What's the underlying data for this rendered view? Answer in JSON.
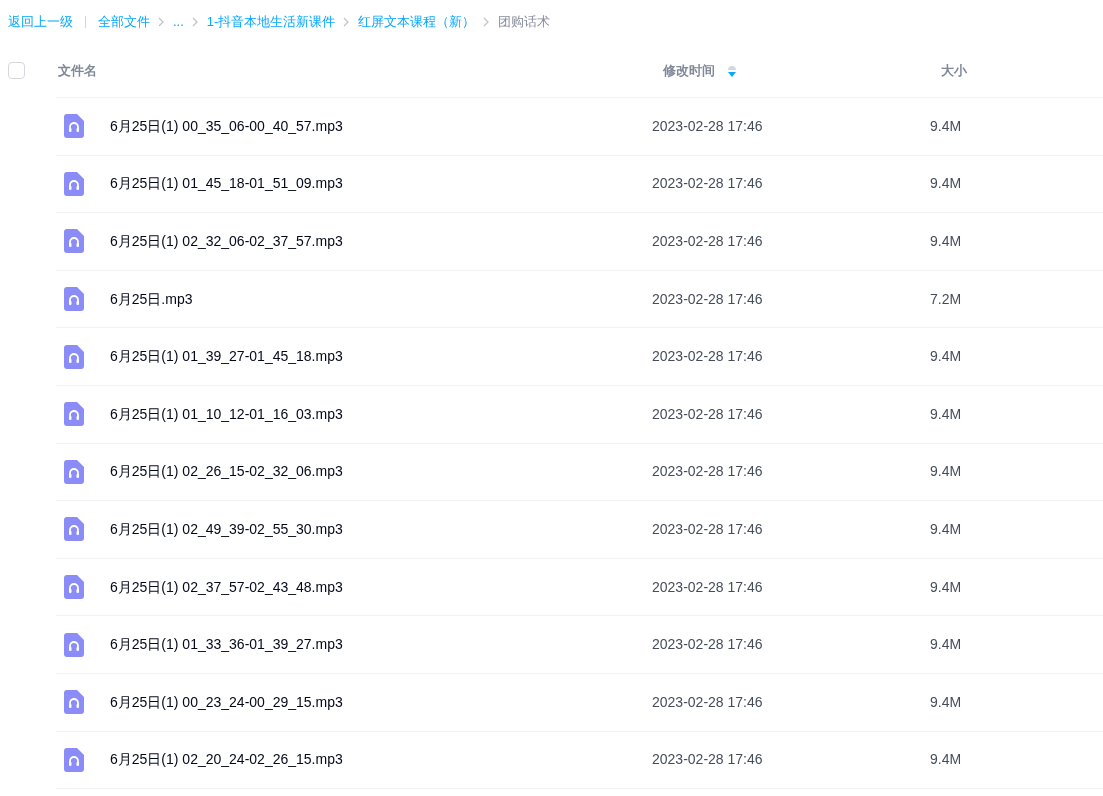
{
  "breadcrumb": {
    "back": "返回上一级",
    "items": [
      {
        "label": "全部文件",
        "current": false
      },
      {
        "label": "...",
        "current": false
      },
      {
        "label": "1-抖音本地生活新课件",
        "current": false
      },
      {
        "label": "红屏文本课程（新）",
        "current": false
      },
      {
        "label": "团购话术",
        "current": true
      }
    ]
  },
  "table": {
    "select_all": {
      "checked": false
    },
    "columns": [
      {
        "label": "文件名",
        "sorted_descending": false
      },
      {
        "label": "修改时间",
        "sorted_descending": true
      },
      {
        "label": "大小",
        "sorted_descending": false
      }
    ],
    "rows": [
      {
        "name": "6月25日(1) 00_35_06-00_40_57.mp3",
        "modified": "2023-02-28 17:46",
        "size": "9.4M"
      },
      {
        "name": "6月25日(1) 01_45_18-01_51_09.mp3",
        "modified": "2023-02-28 17:46",
        "size": "9.4M"
      },
      {
        "name": "6月25日(1) 02_32_06-02_37_57.mp3",
        "modified": "2023-02-28 17:46",
        "size": "9.4M"
      },
      {
        "name": "6月25日.mp3",
        "modified": "2023-02-28 17:46",
        "size": "7.2M"
      },
      {
        "name": "6月25日(1) 01_39_27-01_45_18.mp3",
        "modified": "2023-02-28 17:46",
        "size": "9.4M"
      },
      {
        "name": "6月25日(1) 01_10_12-01_16_03.mp3",
        "modified": "2023-02-28 17:46",
        "size": "9.4M"
      },
      {
        "name": "6月25日(1) 02_26_15-02_32_06.mp3",
        "modified": "2023-02-28 17:46",
        "size": "9.4M"
      },
      {
        "name": "6月25日(1) 02_49_39-02_55_30.mp3",
        "modified": "2023-02-28 17:46",
        "size": "9.4M"
      },
      {
        "name": "6月25日(1) 02_37_57-02_43_48.mp3",
        "modified": "2023-02-28 17:46",
        "size": "9.4M"
      },
      {
        "name": "6月25日(1) 01_33_36-01_39_27.mp3",
        "modified": "2023-02-28 17:46",
        "size": "9.4M"
      },
      {
        "name": "6月25日(1) 00_23_24-00_29_15.mp3",
        "modified": "2023-02-28 17:46",
        "size": "9.4M"
      },
      {
        "name": "6月25日(1) 02_20_24-02_26_15.mp3",
        "modified": "2023-02-28 17:46",
        "size": "9.4M"
      }
    ]
  }
}
